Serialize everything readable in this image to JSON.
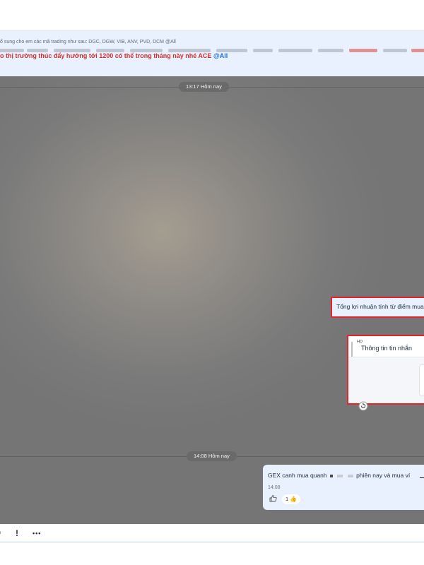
{
  "pinned": {
    "sender_line": "ổ sung cho em các mã trading như sau: DGC, DGW, VIB, ANV, PVD, DCM @All",
    "main_text": "o thị trường thúc đẩy hướng tới 1200 có thể trong tháng này nhé ACE",
    "main_mention": "@All"
  },
  "chat": {
    "divider_1": "13:17 Hôm nay",
    "profit_message": "Tổng lợi nhuận tính từ điểm mua",
    "card": {
      "tag": "HD",
      "title": "Thông tin tin nhắn"
    },
    "divider_2": "14:08 Hôm nay",
    "gex_message": {
      "text_a": "GEX canh mua quanh",
      "text_b": "phiên nay và mua ví",
      "time": "14:08",
      "reaction_count": "1",
      "reaction_emoji": "👍",
      "like_icon": "👍"
    }
  },
  "toolbar": {
    "item_partial": "ᵖ",
    "item_important": "!",
    "item_more": "•••"
  },
  "colors": {
    "accent_red": "#e3242b",
    "mention_blue": "#1a6ee0",
    "bubble_bg": "#e8f1fd"
  }
}
